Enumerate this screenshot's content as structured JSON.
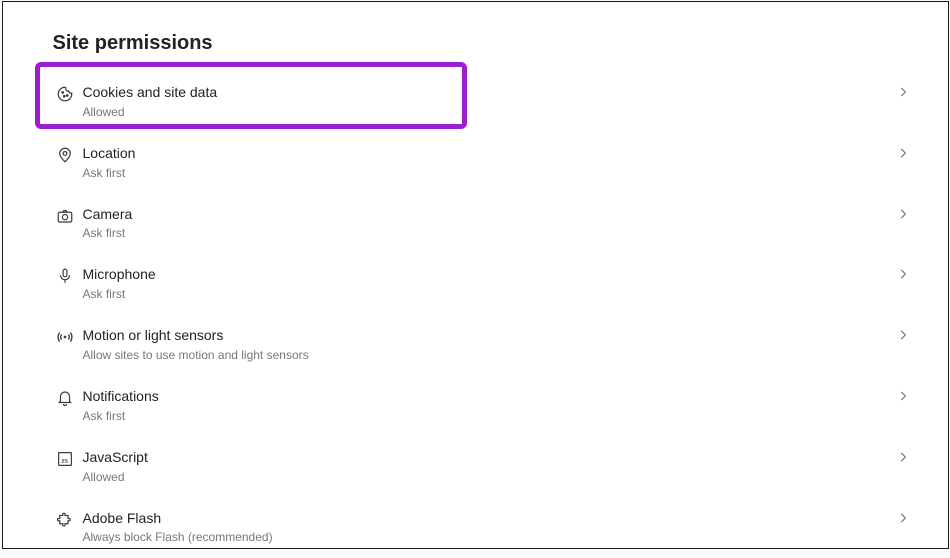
{
  "heading": "Site permissions",
  "items": [
    {
      "title": "Cookies and site data",
      "sub": "Allowed"
    },
    {
      "title": "Location",
      "sub": "Ask first"
    },
    {
      "title": "Camera",
      "sub": "Ask first"
    },
    {
      "title": "Microphone",
      "sub": "Ask first"
    },
    {
      "title": "Motion or light sensors",
      "sub": "Allow sites to use motion and light sensors"
    },
    {
      "title": "Notifications",
      "sub": "Ask first"
    },
    {
      "title": "JavaScript",
      "sub": "Allowed"
    },
    {
      "title": "Adobe Flash",
      "sub": "Always block Flash (recommended)"
    }
  ]
}
